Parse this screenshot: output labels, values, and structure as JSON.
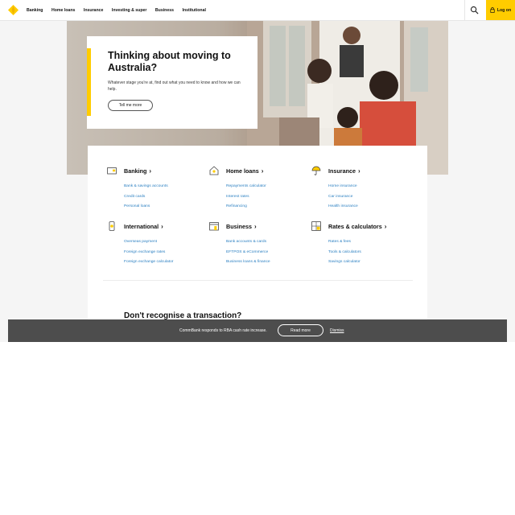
{
  "brand_color": "#ffcc00",
  "nav": {
    "items": [
      "Banking",
      "Home loans",
      "Insurance",
      "Investing & super",
      "Business",
      "Institutional"
    ],
    "search_icon": "search-icon",
    "login_label": "Log on"
  },
  "hero": {
    "title": "Thinking about moving to Australia?",
    "description": "Whatever stage you're at, find out what you need to know and how we can help.",
    "button": "Tell me more"
  },
  "categories": [
    {
      "title": "Banking",
      "icon": "wallet-icon",
      "links": [
        "Bank & savings accounts",
        "Credit cards",
        "Personal loans"
      ]
    },
    {
      "title": "Home loans",
      "icon": "house-icon",
      "links": [
        "Repayments calculator",
        "Interest rates",
        "Refinancing"
      ]
    },
    {
      "title": "Insurance",
      "icon": "umbrella-icon",
      "links": [
        "Home insurance",
        "Car insurance",
        "Health insurance"
      ]
    },
    {
      "title": "International",
      "icon": "phone-globe-icon",
      "links": [
        "Overseas payment",
        "Foreign exchange rates",
        "Foreign exchange calculator"
      ]
    },
    {
      "title": "Business",
      "icon": "storefront-icon",
      "links": [
        "Bank accounts & cards",
        "EFTPOS & eCommerce",
        "Business loans & finance"
      ]
    },
    {
      "title": "Rates & calculators",
      "icon": "calculator-icon",
      "links": [
        "Rates & fees",
        "Tools & calculators",
        "Savings calculator"
      ]
    }
  ],
  "section": {
    "title": "Don't recognise a transaction?"
  },
  "banner": {
    "text": "CommBank responds to RBA cash rate increase.",
    "button": "Read more",
    "dismiss": "Dismiss"
  }
}
